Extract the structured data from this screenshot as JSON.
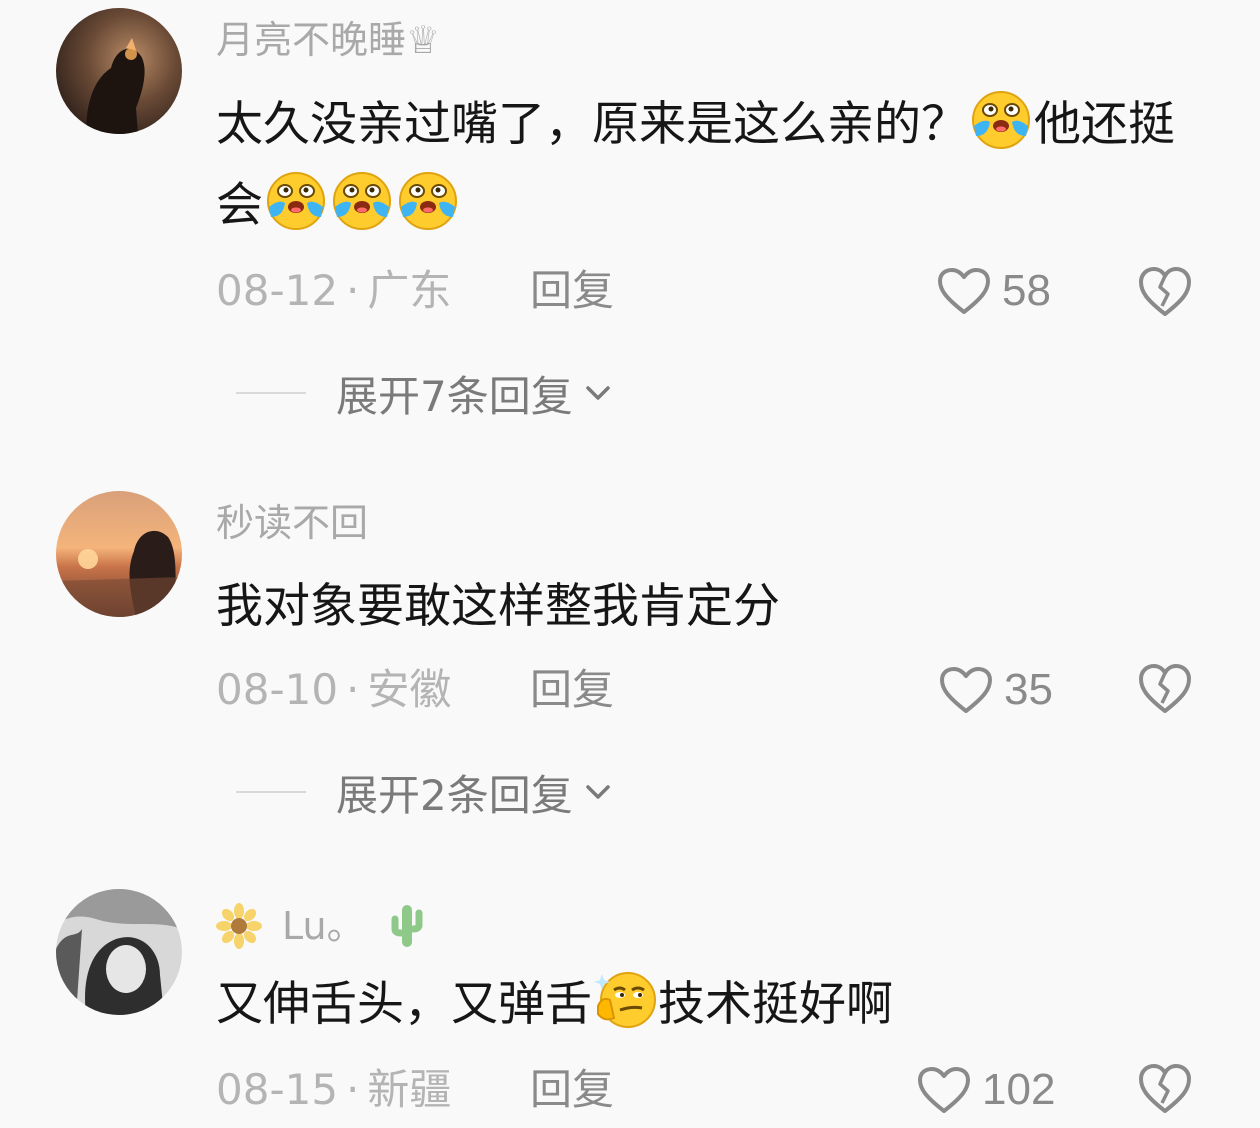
{
  "comments": [
    {
      "username": "月亮不晚睡",
      "username_badge": "♕",
      "text_part1": "太久没亲过嘴了，原来是这么亲的？",
      "text_part2": "他还挺会",
      "date": "08-12",
      "dot": "·",
      "location": "广东",
      "reply_label": "回复",
      "likes": "58",
      "expand_label": "展开7条回复"
    },
    {
      "username": "秒读不回",
      "text": "我对象要敢这样整我肯定分",
      "date": "08-10",
      "dot": "·",
      "location": "安徽",
      "reply_label": "回复",
      "likes": "35",
      "expand_label": "展开2条回复"
    },
    {
      "username": "Lu。",
      "text_part1": "又伸舌头，又弹舌",
      "text_part2": "技术挺好啊",
      "date": "08-15",
      "dot": "·",
      "location": "新疆",
      "reply_label": "回复",
      "likes": "102"
    }
  ],
  "icons": {
    "like": "heart-outline-icon",
    "dislike": "broken-heart-icon",
    "expand": "chevron-down-icon",
    "emoji_cry": "crying-emoji",
    "emoji_smirk": "smirk-emoji"
  },
  "colors": {
    "background": "#f9f9f9",
    "username": "#a9a9a9",
    "text": "#161616",
    "meta": "#b4b4b4",
    "icon_gray": "#8a8a8a"
  }
}
